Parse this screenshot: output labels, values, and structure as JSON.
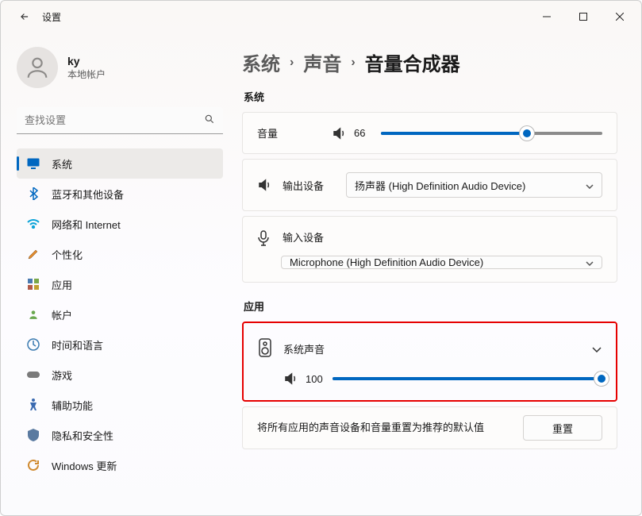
{
  "titlebar": {
    "title": "设置"
  },
  "profile": {
    "name": "ky",
    "subtitle": "本地帐户"
  },
  "search": {
    "placeholder": "查找设置"
  },
  "nav": [
    {
      "id": "system",
      "label": "系统"
    },
    {
      "id": "bluetooth",
      "label": "蓝牙和其他设备"
    },
    {
      "id": "network",
      "label": "网络和 Internet"
    },
    {
      "id": "personalize",
      "label": "个性化"
    },
    {
      "id": "apps",
      "label": "应用"
    },
    {
      "id": "accounts",
      "label": "帐户"
    },
    {
      "id": "time",
      "label": "时间和语言"
    },
    {
      "id": "gaming",
      "label": "游戏"
    },
    {
      "id": "accessibility",
      "label": "辅助功能"
    },
    {
      "id": "privacy",
      "label": "隐私和安全性"
    },
    {
      "id": "update",
      "label": "Windows 更新"
    }
  ],
  "breadcrumb": {
    "p0": "系统",
    "p1": "声音",
    "p2": "音量合成器"
  },
  "sections": {
    "system": "系统",
    "apps": "应用"
  },
  "volume_card": {
    "label": "音量",
    "value": "66",
    "percent": 66
  },
  "output_card": {
    "label": "输出设备",
    "value": "扬声器 (High Definition Audio Device)"
  },
  "input_card": {
    "label": "输入设备",
    "value": "Microphone (High Definition Audio Device)"
  },
  "system_sounds": {
    "title": "系统声音",
    "value": "100",
    "percent": 100
  },
  "reset": {
    "text": "将所有应用的声音设备和音量重置为推荐的默认值",
    "button": "重置"
  }
}
